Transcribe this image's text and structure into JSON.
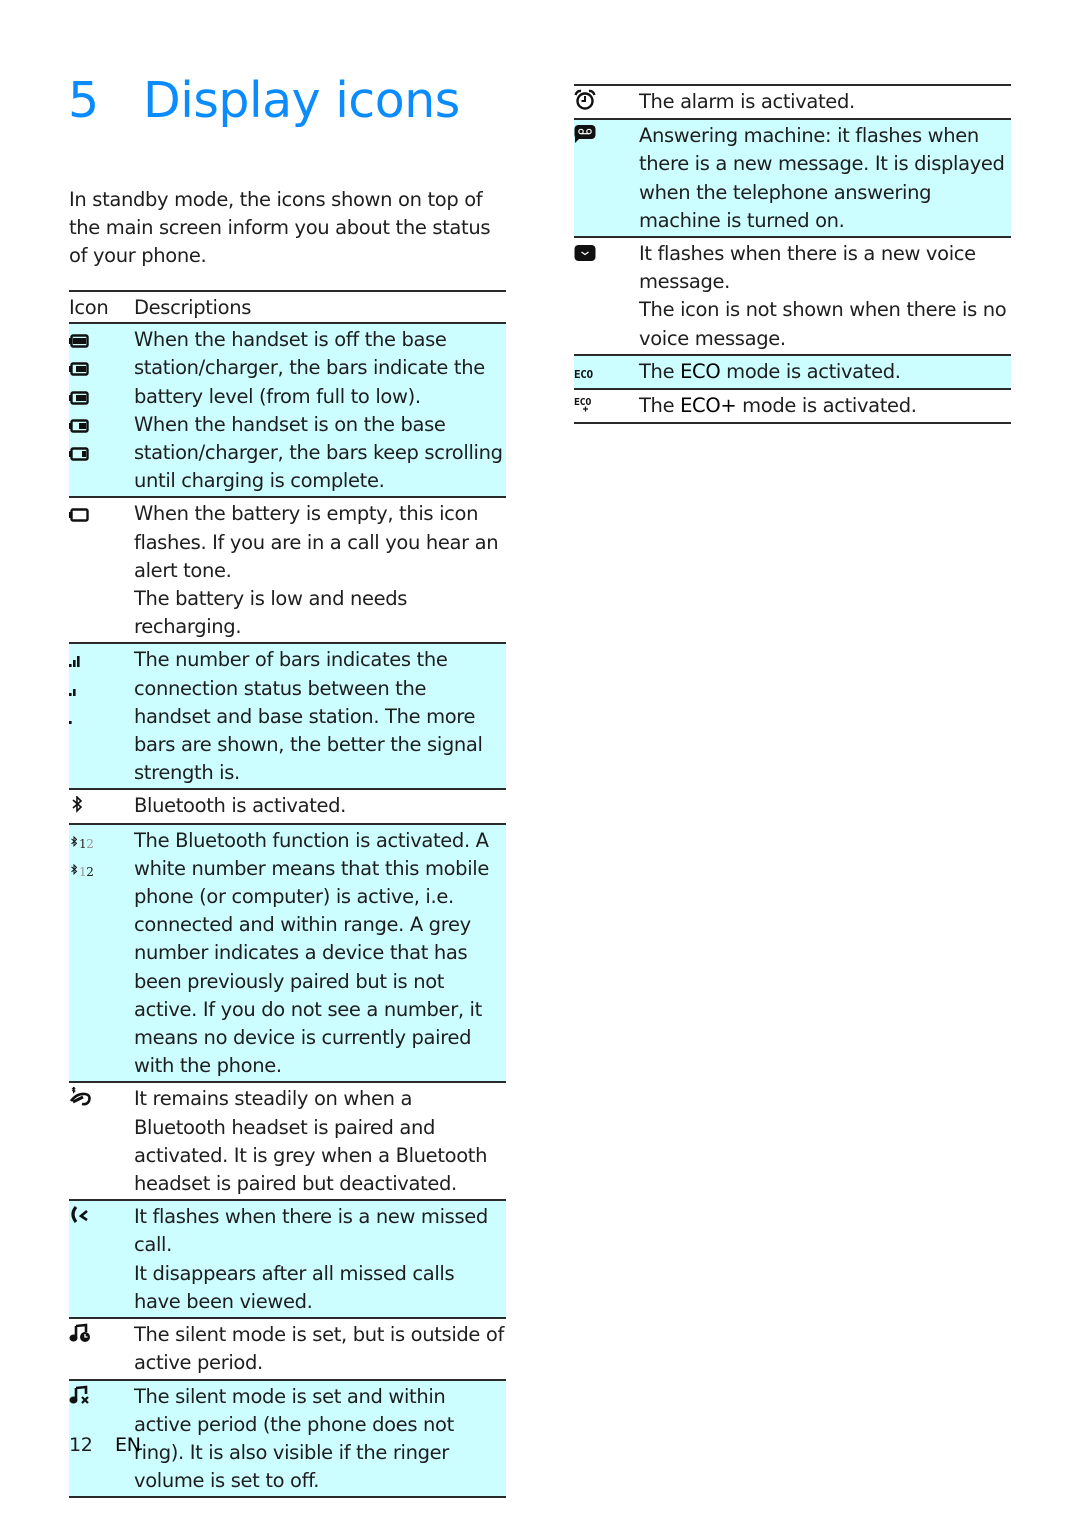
{
  "heading": {
    "number": "5",
    "title": "Display icons"
  },
  "intro": "In standby mode, the icons shown on top of the main screen inform you about the status of your phone.",
  "table": {
    "header": {
      "icon": "Icon",
      "description": "Descriptions"
    },
    "left_rows": [
      {
        "icons": [
          "battery-full-icon",
          "battery-3-bars-icon",
          "battery-2-bars-icon",
          "battery-1-bar-icon",
          "battery-low-icon"
        ],
        "shaded": true,
        "lines": [
          "When the handset is off the base station/charger, the bars indicate the battery level (from full to low).",
          "When the handset is on the base station/charger, the bars keep scrolling until charging is complete."
        ]
      },
      {
        "icons": [
          "battery-empty-icon"
        ],
        "shaded": false,
        "lines": [
          "When the battery is empty, this icon flashes. If you are in a call you hear an alert tone.",
          "The battery is low and needs recharging."
        ]
      },
      {
        "icons": [
          "signal-3-bars-icon",
          "signal-2-bars-icon",
          "signal-1-bar-icon"
        ],
        "shaded": true,
        "lines": [
          "The number of bars indicates the connection status between the handset and base station. The more bars are shown, the better the signal strength is."
        ]
      },
      {
        "icons": [
          "bluetooth-icon"
        ],
        "shaded": false,
        "lines": [
          "Bluetooth is activated."
        ]
      },
      {
        "icons": [
          "bluetooth-device-1-active-icon",
          "bluetooth-device-2-active-icon"
        ],
        "shaded": true,
        "lines": [
          "The Bluetooth function is activated. A white number means that this mobile phone (or computer) is active, i.e. connected and within range. A grey number indicates a device that has been previously paired but is not active. If you do not see a number, it means no device is currently paired with the phone."
        ]
      },
      {
        "icons": [
          "bluetooth-headset-icon"
        ],
        "shaded": false,
        "lines": [
          "It remains steadily on when a Bluetooth headset is paired and activated. It is grey when a Bluetooth headset is paired but deactivated."
        ]
      },
      {
        "icons": [
          "missed-call-icon"
        ],
        "shaded": true,
        "lines": [
          "It flashes when there is a new missed call.",
          "It disappears after all missed calls have been viewed."
        ]
      },
      {
        "icons": [
          "silent-mode-scheduled-icon"
        ],
        "shaded": false,
        "lines": [
          "The silent mode is set, but is outside of active period."
        ]
      },
      {
        "icons": [
          "silent-mode-active-icon"
        ],
        "shaded": true,
        "lines": [
          "The silent mode is set and within active period (the phone does not ring). It is also visible if the ringer volume is set to off."
        ]
      }
    ],
    "right_rows": [
      {
        "icons": [
          "alarm-icon"
        ],
        "shaded": false,
        "lines": [
          "The alarm is activated."
        ]
      },
      {
        "icons": [
          "answering-machine-icon"
        ],
        "shaded": true,
        "lines": [
          "Answering machine: it flashes when there is a new message. It is displayed when the telephone answering machine is turned on."
        ]
      },
      {
        "icons": [
          "voice-message-icon"
        ],
        "shaded": false,
        "lines": [
          "It flashes when there is a new voice message.",
          "The icon is not shown when there is no voice message."
        ]
      },
      {
        "icons": [
          "eco-mode-icon"
        ],
        "shaded": true,
        "pre": "The ",
        "bold": "ECO",
        "post": " mode is activated."
      },
      {
        "icons": [
          "eco-plus-mode-icon"
        ],
        "shaded": false,
        "pre": "The ",
        "bold": "ECO+",
        "post": " mode is activated."
      }
    ],
    "bluetooth_numbers": {
      "first": "1",
      "second": "2"
    },
    "eco_label": "ECO"
  },
  "colors": {
    "heading": "#0a8cff",
    "row_shade": "#ccfdff",
    "rule": "#2a2a2a"
  },
  "footer": {
    "page_number": "12",
    "language": "EN"
  }
}
